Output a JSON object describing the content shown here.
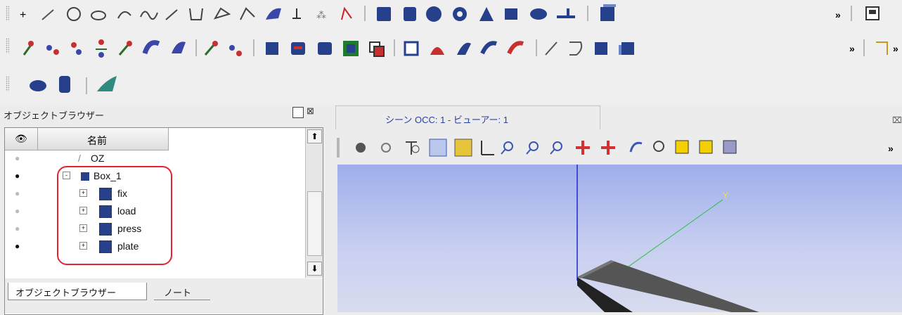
{
  "toolbar_rows": {
    "row1_icons": [
      "point-icon",
      "line-icon",
      "circle-icon",
      "ellipse-icon",
      "arc-icon",
      "curve-icon",
      "vector-icon",
      "polyline-icon",
      "plane-icon",
      "sketch-icon",
      "surface-icon",
      "local-cs-icon",
      "explode-icon",
      "translate-icon",
      "box-icon",
      "cylinder-icon",
      "sphere-icon",
      "torus-icon",
      "cone-icon",
      "rectangle-icon",
      "disk-icon",
      "tool-icon",
      "cube-icon",
      "more-icon",
      "picture-icon"
    ],
    "row2_icons": [
      "extrude-icon",
      "revolve-icon",
      "fillet-icon",
      "chamfer-icon",
      "extrude-along-icon",
      "pipe-icon",
      "thickness-icon",
      "add-point-icon",
      "add-points-icon",
      "boolean-cut-icon",
      "boolean-fuse-icon",
      "boolean-common-icon",
      "section-icon",
      "partition-icon",
      "shell-icon",
      "face-icon",
      "surface-fill-icon",
      "blend-icon",
      "solid-icon",
      "edge-icon",
      "wire-icon",
      "face-square-icon",
      "shell-square-icon",
      "more-icon",
      "marker-icon"
    ],
    "row3_icons": [
      "ellipsoid-icon",
      "cylinder-mesh-icon",
      "smooth-surface-icon"
    ]
  },
  "object_browser": {
    "title": "オブジェクトブラウザー",
    "columns": {
      "visibility_header": "eye-icon",
      "name_header": "名前"
    },
    "rows": [
      {
        "name": "OZ",
        "visible": false,
        "indent": 0,
        "kind": "axis"
      },
      {
        "name": "Box_1",
        "visible": true,
        "indent": 0,
        "kind": "box",
        "expanded": true
      },
      {
        "name": "fix",
        "visible": false,
        "indent": 1,
        "kind": "group"
      },
      {
        "name": "load",
        "visible": false,
        "indent": 1,
        "kind": "group"
      },
      {
        "name": "press",
        "visible": false,
        "indent": 1,
        "kind": "group"
      },
      {
        "name": "plate",
        "visible": true,
        "indent": 1,
        "kind": "group"
      }
    ],
    "tabs": {
      "browser": "オブジェクトブラウザー",
      "notes": "ノート"
    }
  },
  "viewer": {
    "title": "シーン OCC: 1 - ビューアー: 1",
    "toolbar_icons": [
      "dump-view-icon",
      "view-mode-icon",
      "hidden-lines-icon",
      "select-icon",
      "selection-mode-icon",
      "triedre-icon",
      "fit-all-icon",
      "fit-area-icon",
      "zoom-icon",
      "pan-icon",
      "global-pan-icon",
      "rotate-icon",
      "rotation-point-icon",
      "front-view-icon",
      "back-view-icon",
      "top-view-icon",
      "more-icon"
    ],
    "axis_label": "Y"
  },
  "colors": {
    "highlight": "#e6222e",
    "axis_y": "#27c13a",
    "axis_z": "#1c2ac9",
    "axis_y_label": "#f2e628",
    "shape": "#4a4a4a"
  }
}
